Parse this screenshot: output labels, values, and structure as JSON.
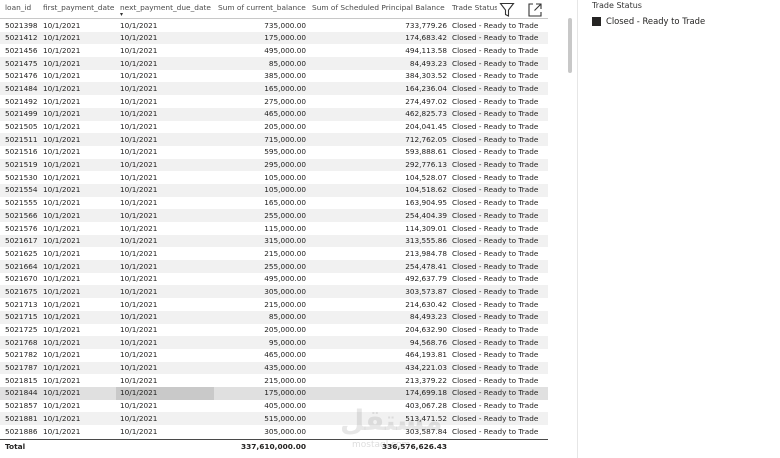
{
  "table": {
    "columns": {
      "loan_id": "loan_id",
      "first_payment_date": "first_payment_date",
      "next_payment_due_date": "next_payment_due_date",
      "sum_current_balance": "Sum of current_balance",
      "sum_scheduled_principal_balance": "Sum of Scheduled Principal Balance",
      "trade_status": "Trade Status"
    },
    "sort_indicator": "▾",
    "rows": [
      [
        "5021398",
        "10/1/2021",
        "10/1/2021",
        "735,000.00",
        "733,779.26",
        "Closed - Ready to Trade"
      ],
      [
        "5021412",
        "10/1/2021",
        "10/1/2021",
        "175,000.00",
        "174,683.42",
        "Closed - Ready to Trade"
      ],
      [
        "5021456",
        "10/1/2021",
        "10/1/2021",
        "495,000.00",
        "494,113.58",
        "Closed - Ready to Trade"
      ],
      [
        "5021475",
        "10/1/2021",
        "10/1/2021",
        "85,000.00",
        "84,493.23",
        "Closed - Ready to Trade"
      ],
      [
        "5021476",
        "10/1/2021",
        "10/1/2021",
        "385,000.00",
        "384,303.52",
        "Closed - Ready to Trade"
      ],
      [
        "5021484",
        "10/1/2021",
        "10/1/2021",
        "165,000.00",
        "164,236.04",
        "Closed - Ready to Trade"
      ],
      [
        "5021492",
        "10/1/2021",
        "10/1/2021",
        "275,000.00",
        "274,497.02",
        "Closed - Ready to Trade"
      ],
      [
        "5021499",
        "10/1/2021",
        "10/1/2021",
        "465,000.00",
        "462,825.73",
        "Closed - Ready to Trade"
      ],
      [
        "5021505",
        "10/1/2021",
        "10/1/2021",
        "205,000.00",
        "204,041.45",
        "Closed - Ready to Trade"
      ],
      [
        "5021511",
        "10/1/2021",
        "10/1/2021",
        "715,000.00",
        "712,762.05",
        "Closed - Ready to Trade"
      ],
      [
        "5021516",
        "10/1/2021",
        "10/1/2021",
        "595,000.00",
        "593,888.61",
        "Closed - Ready to Trade"
      ],
      [
        "5021519",
        "10/1/2021",
        "10/1/2021",
        "295,000.00",
        "292,776.13",
        "Closed - Ready to Trade"
      ],
      [
        "5021530",
        "10/1/2021",
        "10/1/2021",
        "105,000.00",
        "104,528.07",
        "Closed - Ready to Trade"
      ],
      [
        "5021554",
        "10/1/2021",
        "10/1/2021",
        "105,000.00",
        "104,518.62",
        "Closed - Ready to Trade"
      ],
      [
        "5021555",
        "10/1/2021",
        "10/1/2021",
        "165,000.00",
        "163,904.95",
        "Closed - Ready to Trade"
      ],
      [
        "5021566",
        "10/1/2021",
        "10/1/2021",
        "255,000.00",
        "254,404.39",
        "Closed - Ready to Trade"
      ],
      [
        "5021576",
        "10/1/2021",
        "10/1/2021",
        "115,000.00",
        "114,309.01",
        "Closed - Ready to Trade"
      ],
      [
        "5021617",
        "10/1/2021",
        "10/1/2021",
        "315,000.00",
        "313,555.86",
        "Closed - Ready to Trade"
      ],
      [
        "5021625",
        "10/1/2021",
        "10/1/2021",
        "215,000.00",
        "213,984.78",
        "Closed - Ready to Trade"
      ],
      [
        "5021664",
        "10/1/2021",
        "10/1/2021",
        "255,000.00",
        "254,478.41",
        "Closed - Ready to Trade"
      ],
      [
        "5021670",
        "10/1/2021",
        "10/1/2021",
        "495,000.00",
        "492,637.79",
        "Closed - Ready to Trade"
      ],
      [
        "5021675",
        "10/1/2021",
        "10/1/2021",
        "305,000.00",
        "303,573.87",
        "Closed - Ready to Trade"
      ],
      [
        "5021713",
        "10/1/2021",
        "10/1/2021",
        "215,000.00",
        "214,630.42",
        "Closed - Ready to Trade"
      ],
      [
        "5021715",
        "10/1/2021",
        "10/1/2021",
        "85,000.00",
        "84,493.23",
        "Closed - Ready to Trade"
      ],
      [
        "5021725",
        "10/1/2021",
        "10/1/2021",
        "205,000.00",
        "204,632.90",
        "Closed - Ready to Trade"
      ],
      [
        "5021768",
        "10/1/2021",
        "10/1/2021",
        "95,000.00",
        "94,568.76",
        "Closed - Ready to Trade"
      ],
      [
        "5021782",
        "10/1/2021",
        "10/1/2021",
        "465,000.00",
        "464,193.81",
        "Closed - Ready to Trade"
      ],
      [
        "5021787",
        "10/1/2021",
        "10/1/2021",
        "435,000.00",
        "434,221.03",
        "Closed - Ready to Trade"
      ],
      [
        "5021815",
        "10/1/2021",
        "10/1/2021",
        "215,000.00",
        "213,379.22",
        "Closed - Ready to Trade"
      ],
      [
        "5021844",
        "10/1/2021",
        "10/1/2021",
        "175,000.00",
        "174,699.18",
        "Closed - Ready to Trade"
      ],
      [
        "5021857",
        "10/1/2021",
        "10/1/2021",
        "405,000.00",
        "403,067.28",
        "Closed - Ready to Trade"
      ],
      [
        "5021881",
        "10/1/2021",
        "10/1/2021",
        "515,000.00",
        "513,471.52",
        "Closed - Ready to Trade"
      ],
      [
        "5021886",
        "10/1/2021",
        "10/1/2021",
        "305,000.00",
        "303,587.84",
        "Closed - Ready to Trade"
      ]
    ],
    "highlighted_row": 29,
    "total": {
      "label": "Total",
      "sum_current_balance": "337,610,000.00",
      "sum_scheduled_principal_balance": "336,576,626.43"
    }
  },
  "toolbar": {
    "filter_icon": "filter-icon",
    "focus_icon": "focus-mode-icon"
  },
  "slicer": {
    "title": "Trade Status",
    "items": [
      {
        "label": "Closed - Ready to Trade",
        "selected": true
      }
    ]
  },
  "watermark": {
    "text": "مستقل",
    "sub": "mostaql.com"
  },
  "colors": {
    "alt_row": "#f1f1f1",
    "highlight_row": "#e0e0e0",
    "slicer_box": "#252423"
  }
}
